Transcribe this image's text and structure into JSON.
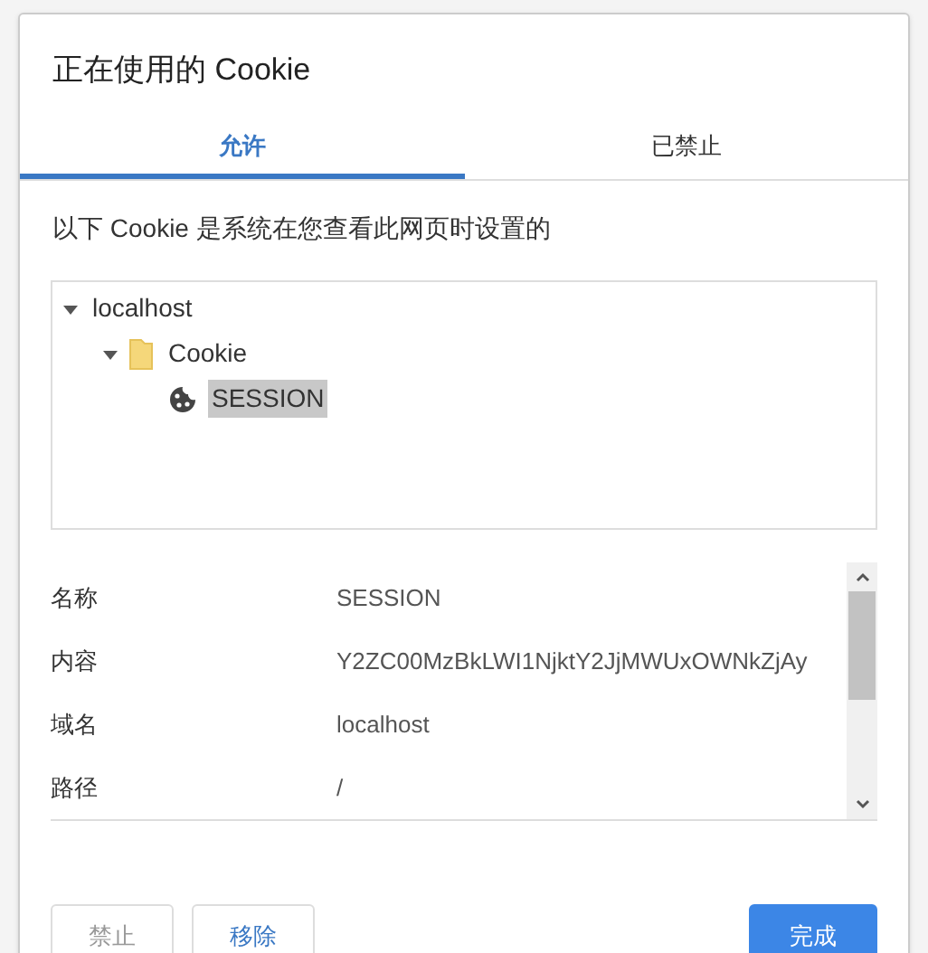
{
  "dialog": {
    "title": "正在使用的 Cookie"
  },
  "tabs": [
    {
      "label": "允许",
      "selected": true
    },
    {
      "label": "已禁止",
      "selected": false
    }
  ],
  "description": "以下 Cookie 是系统在您查看此网页时设置的",
  "tree": [
    {
      "label": "localhost",
      "expanded": true,
      "selected": false,
      "children": [
        {
          "label": "Cookie",
          "kind": "folder",
          "expanded": true,
          "selected": false,
          "children": [
            {
              "label": "SESSION",
              "kind": "cookie",
              "selected": true
            }
          ]
        }
      ]
    }
  ],
  "details": [
    {
      "label": "名称",
      "value": "SESSION"
    },
    {
      "label": "内容",
      "value": "Y2ZC00MzBkLWI1NjktY2JjMWUxOWNkZjAy"
    },
    {
      "label": "域名",
      "value": "localhost"
    },
    {
      "label": "路径",
      "value": "/"
    }
  ],
  "buttons": [
    {
      "label": "禁止",
      "kind": "secondary",
      "disabled": true
    },
    {
      "label": "移除",
      "kind": "secondary",
      "disabled": false
    },
    {
      "label": "完成",
      "kind": "primary",
      "disabled": false
    }
  ]
}
